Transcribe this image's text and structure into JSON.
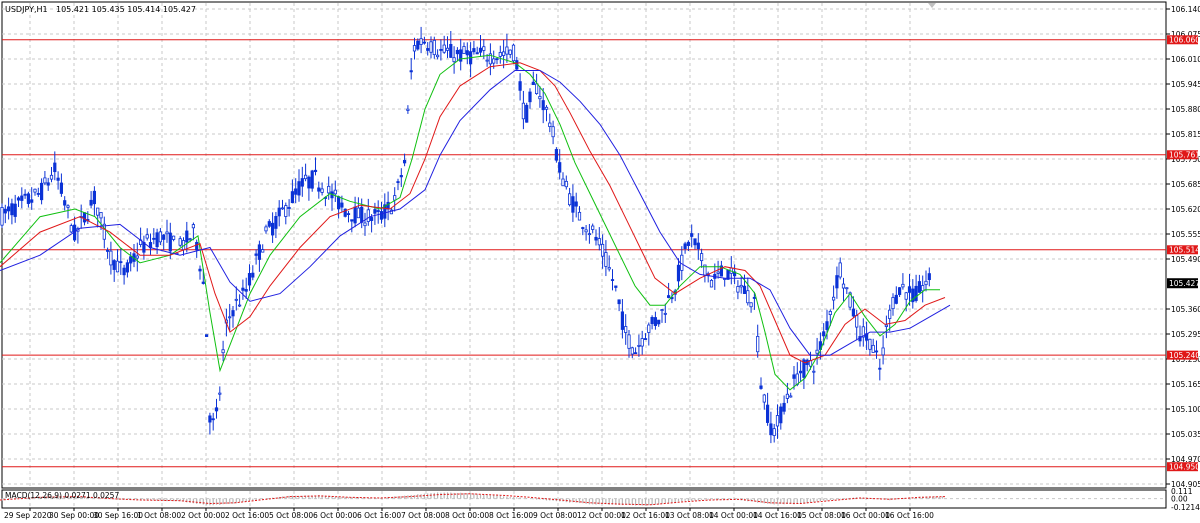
{
  "window": {
    "symbol_title": "USDJPY,H1",
    "ohlc": "105.421 105.435 105.414 105.427"
  },
  "colors": {
    "background": "#ffffff",
    "grid": "#c8c8c8",
    "candle": "#0b32d6",
    "level_line": "#e01818",
    "level_tag_bg": "#e01818",
    "current_price_bg": "#000000",
    "ma_fast": "#10c010",
    "ma_mid": "#e01818",
    "ma_slow": "#2020e0",
    "macd_hist": "#b8b8b8",
    "macd_signal": "#e01818"
  },
  "chart_data": [
    {
      "type": "candlestick",
      "price_axis": {
        "ticks": [
          106.14,
          106.075,
          106.01,
          105.945,
          105.88,
          105.815,
          105.75,
          105.685,
          105.62,
          105.555,
          105.49,
          105.36,
          105.295,
          105.23,
          105.165,
          105.1,
          105.035,
          104.97,
          104.905
        ],
        "ylim": [
          104.905,
          106.14
        ]
      },
      "time_axis": {
        "labels": [
          "29 Sep 2020",
          "30 Sep 00:00",
          "30 Sep 16:00",
          "1 Oct 08:00",
          "2 Oct 00:00",
          "2 Oct 16:00",
          "5 Oct 08:00",
          "6 Oct 00:00",
          "6 Oct 16:00",
          "7 Oct 08:00",
          "8 Oct 00:00",
          "8 Oct 16:00",
          "9 Oct 08:00",
          "12 Oct 00:00",
          "12 Oct 16:00",
          "13 Oct 08:00",
          "14 Oct 00:00",
          "14 Oct 16:00",
          "15 Oct 08:00",
          "16 Oct 00:00",
          "16 Oct 16:00"
        ]
      },
      "horizontal_levels": [
        106.06,
        105.761,
        105.514,
        105.24,
        104.95
      ],
      "current_price": 105.427,
      "grid": true,
      "path_points": [
        [
          0,
          105.6
        ],
        [
          40,
          105.66
        ],
        [
          55,
          105.72
        ],
        [
          75,
          105.55
        ],
        [
          95,
          105.65
        ],
        [
          110,
          105.5
        ],
        [
          125,
          105.45
        ],
        [
          140,
          105.52
        ],
        [
          160,
          105.55
        ],
        [
          180,
          105.52
        ],
        [
          195,
          105.56
        ],
        [
          205,
          105.4
        ],
        [
          210,
          105.08
        ],
        [
          215,
          105.05
        ],
        [
          220,
          105.15
        ],
        [
          225,
          105.3
        ],
        [
          232,
          105.36
        ],
        [
          245,
          105.4
        ],
        [
          265,
          105.55
        ],
        [
          285,
          105.62
        ],
        [
          300,
          105.68
        ],
        [
          315,
          105.7
        ],
        [
          330,
          105.66
        ],
        [
          345,
          105.62
        ],
        [
          360,
          105.6
        ],
        [
          380,
          105.6
        ],
        [
          395,
          105.64
        ],
        [
          405,
          105.75
        ],
        [
          410,
          105.95
        ],
        [
          415,
          106.05
        ],
        [
          425,
          106.06
        ],
        [
          440,
          106.03
        ],
        [
          460,
          106.02
        ],
        [
          480,
          106.02
        ],
        [
          500,
          106.02
        ],
        [
          515,
          106.03
        ],
        [
          525,
          105.85
        ],
        [
          535,
          105.95
        ],
        [
          550,
          105.85
        ],
        [
          560,
          105.72
        ],
        [
          570,
          105.65
        ],
        [
          580,
          105.6
        ],
        [
          595,
          105.55
        ],
        [
          605,
          105.49
        ],
        [
          615,
          105.42
        ],
        [
          625,
          105.3
        ],
        [
          635,
          105.25
        ],
        [
          645,
          105.3
        ],
        [
          660,
          105.34
        ],
        [
          675,
          105.42
        ],
        [
          690,
          105.55
        ],
        [
          700,
          105.5
        ],
        [
          712,
          105.43
        ],
        [
          725,
          105.46
        ],
        [
          740,
          105.42
        ],
        [
          755,
          105.38
        ],
        [
          760,
          105.18
        ],
        [
          770,
          105.06
        ],
        [
          775,
          105.04
        ],
        [
          785,
          105.12
        ],
        [
          800,
          105.2
        ],
        [
          815,
          105.22
        ],
        [
          825,
          105.3
        ],
        [
          840,
          105.47
        ],
        [
          850,
          105.38
        ],
        [
          860,
          105.3
        ],
        [
          870,
          105.28
        ],
        [
          880,
          105.2
        ],
        [
          890,
          105.36
        ],
        [
          900,
          105.42
        ],
        [
          915,
          105.39
        ],
        [
          925,
          105.43
        ],
        [
          932,
          105.427
        ]
      ],
      "ma_fast_points": [
        [
          0,
          105.48
        ],
        [
          40,
          105.6
        ],
        [
          75,
          105.62
        ],
        [
          95,
          105.6
        ],
        [
          120,
          105.52
        ],
        [
          140,
          105.48
        ],
        [
          170,
          105.5
        ],
        [
          198,
          105.55
        ],
        [
          210,
          105.35
        ],
        [
          220,
          105.2
        ],
        [
          232,
          105.28
        ],
        [
          250,
          105.4
        ],
        [
          270,
          105.5
        ],
        [
          300,
          105.6
        ],
        [
          330,
          105.66
        ],
        [
          350,
          105.64
        ],
        [
          380,
          105.62
        ],
        [
          400,
          105.65
        ],
        [
          412,
          105.75
        ],
        [
          425,
          105.88
        ],
        [
          440,
          105.97
        ],
        [
          460,
          106.01
        ],
        [
          490,
          106.02
        ],
        [
          515,
          106.0
        ],
        [
          530,
          105.97
        ],
        [
          545,
          105.92
        ],
        [
          560,
          105.84
        ],
        [
          575,
          105.74
        ],
        [
          590,
          105.66
        ],
        [
          605,
          105.58
        ],
        [
          620,
          105.5
        ],
        [
          635,
          105.42
        ],
        [
          650,
          105.37
        ],
        [
          665,
          105.37
        ],
        [
          680,
          105.42
        ],
        [
          700,
          105.47
        ],
        [
          720,
          105.47
        ],
        [
          740,
          105.45
        ],
        [
          755,
          105.4
        ],
        [
          765,
          105.3
        ],
        [
          775,
          105.19
        ],
        [
          790,
          105.15
        ],
        [
          805,
          105.18
        ],
        [
          820,
          105.25
        ],
        [
          835,
          105.35
        ],
        [
          850,
          105.4
        ],
        [
          865,
          105.34
        ],
        [
          880,
          105.29
        ],
        [
          895,
          105.32
        ],
        [
          910,
          105.38
        ],
        [
          925,
          105.41
        ],
        [
          940,
          105.41
        ]
      ],
      "ma_mid_points": [
        [
          0,
          105.47
        ],
        [
          40,
          105.56
        ],
        [
          80,
          105.6
        ],
        [
          110,
          105.56
        ],
        [
          140,
          105.5
        ],
        [
          170,
          105.5
        ],
        [
          200,
          105.53
        ],
        [
          215,
          105.4
        ],
        [
          230,
          105.3
        ],
        [
          250,
          105.34
        ],
        [
          270,
          105.42
        ],
        [
          300,
          105.52
        ],
        [
          330,
          105.6
        ],
        [
          360,
          105.63
        ],
        [
          390,
          105.62
        ],
        [
          410,
          105.66
        ],
        [
          425,
          105.75
        ],
        [
          440,
          105.86
        ],
        [
          460,
          105.94
        ],
        [
          490,
          105.99
        ],
        [
          520,
          106.0
        ],
        [
          540,
          105.98
        ],
        [
          555,
          105.94
        ],
        [
          570,
          105.87
        ],
        [
          590,
          105.77
        ],
        [
          610,
          105.68
        ],
        [
          625,
          105.6
        ],
        [
          640,
          105.52
        ],
        [
          655,
          105.44
        ],
        [
          675,
          105.4
        ],
        [
          700,
          105.44
        ],
        [
          725,
          105.47
        ],
        [
          745,
          105.46
        ],
        [
          760,
          105.42
        ],
        [
          775,
          105.33
        ],
        [
          790,
          105.24
        ],
        [
          805,
          105.22
        ],
        [
          825,
          105.24
        ],
        [
          845,
          105.32
        ],
        [
          865,
          105.36
        ],
        [
          885,
          105.32
        ],
        [
          905,
          105.33
        ],
        [
          925,
          105.37
        ],
        [
          945,
          105.39
        ]
      ],
      "ma_slow_points": [
        [
          0,
          105.46
        ],
        [
          40,
          105.5
        ],
        [
          80,
          105.57
        ],
        [
          120,
          105.58
        ],
        [
          150,
          105.52
        ],
        [
          180,
          105.5
        ],
        [
          210,
          105.52
        ],
        [
          230,
          105.43
        ],
        [
          250,
          105.38
        ],
        [
          280,
          105.4
        ],
        [
          310,
          105.47
        ],
        [
          340,
          105.55
        ],
        [
          370,
          105.6
        ],
        [
          400,
          105.62
        ],
        [
          425,
          105.67
        ],
        [
          440,
          105.76
        ],
        [
          460,
          105.85
        ],
        [
          490,
          105.93
        ],
        [
          515,
          105.98
        ],
        [
          540,
          105.98
        ],
        [
          560,
          105.95
        ],
        [
          580,
          105.9
        ],
        [
          600,
          105.84
        ],
        [
          620,
          105.76
        ],
        [
          640,
          105.66
        ],
        [
          660,
          105.56
        ],
        [
          680,
          105.48
        ],
        [
          700,
          105.45
        ],
        [
          725,
          105.44
        ],
        [
          750,
          105.44
        ],
        [
          770,
          105.41
        ],
        [
          790,
          105.31
        ],
        [
          810,
          105.24
        ],
        [
          830,
          105.24
        ],
        [
          850,
          105.27
        ],
        [
          870,
          105.3
        ],
        [
          890,
          105.3
        ],
        [
          910,
          105.31
        ],
        [
          930,
          105.34
        ],
        [
          950,
          105.37
        ]
      ]
    },
    {
      "type": "macd",
      "label": "MACD(12,26,9) 0.0271 0.0257",
      "ticks": [
        0.111,
        0.0,
        -0.1214
      ],
      "ylim": [
        -0.1214,
        0.111
      ],
      "signal_points": [
        [
          0,
          -0.02
        ],
        [
          40,
          0.02
        ],
        [
          80,
          0.03
        ],
        [
          110,
          0.0
        ],
        [
          140,
          -0.02
        ],
        [
          180,
          -0.03
        ],
        [
          210,
          -0.07
        ],
        [
          235,
          -0.06
        ],
        [
          260,
          -0.02
        ],
        [
          290,
          0.03
        ],
        [
          320,
          0.04
        ],
        [
          350,
          0.02
        ],
        [
          380,
          0.01
        ],
        [
          410,
          0.03
        ],
        [
          440,
          0.06
        ],
        [
          470,
          0.07
        ],
        [
          500,
          0.05
        ],
        [
          530,
          0.02
        ],
        [
          560,
          -0.02
        ],
        [
          590,
          -0.06
        ],
        [
          620,
          -0.08
        ],
        [
          650,
          -0.09
        ],
        [
          680,
          -0.05
        ],
        [
          710,
          -0.02
        ],
        [
          740,
          -0.01
        ],
        [
          770,
          -0.06
        ],
        [
          800,
          -0.07
        ],
        [
          830,
          -0.03
        ],
        [
          860,
          0.01
        ],
        [
          890,
          -0.01
        ],
        [
          920,
          0.02
        ],
        [
          945,
          0.03
        ]
      ],
      "hist_points": [
        [
          0,
          -0.03
        ],
        [
          40,
          0.03
        ],
        [
          80,
          0.04
        ],
        [
          110,
          -0.01
        ],
        [
          140,
          -0.02
        ],
        [
          180,
          -0.04
        ],
        [
          210,
          -0.1
        ],
        [
          235,
          -0.07
        ],
        [
          260,
          -0.01
        ],
        [
          290,
          0.04
        ],
        [
          320,
          0.05
        ],
        [
          350,
          0.02
        ],
        [
          380,
          0.01
        ],
        [
          410,
          0.05
        ],
        [
          440,
          0.09
        ],
        [
          470,
          0.08
        ],
        [
          500,
          0.04
        ],
        [
          530,
          0.0
        ],
        [
          560,
          -0.04
        ],
        [
          590,
          -0.08
        ],
        [
          620,
          -0.09
        ],
        [
          650,
          -0.1
        ],
        [
          680,
          -0.04
        ],
        [
          710,
          -0.01
        ],
        [
          740,
          -0.02
        ],
        [
          770,
          -0.08
        ],
        [
          800,
          -0.08
        ],
        [
          830,
          -0.02
        ],
        [
          860,
          0.02
        ],
        [
          890,
          -0.02
        ],
        [
          920,
          0.03
        ],
        [
          945,
          0.03
        ]
      ]
    }
  ]
}
